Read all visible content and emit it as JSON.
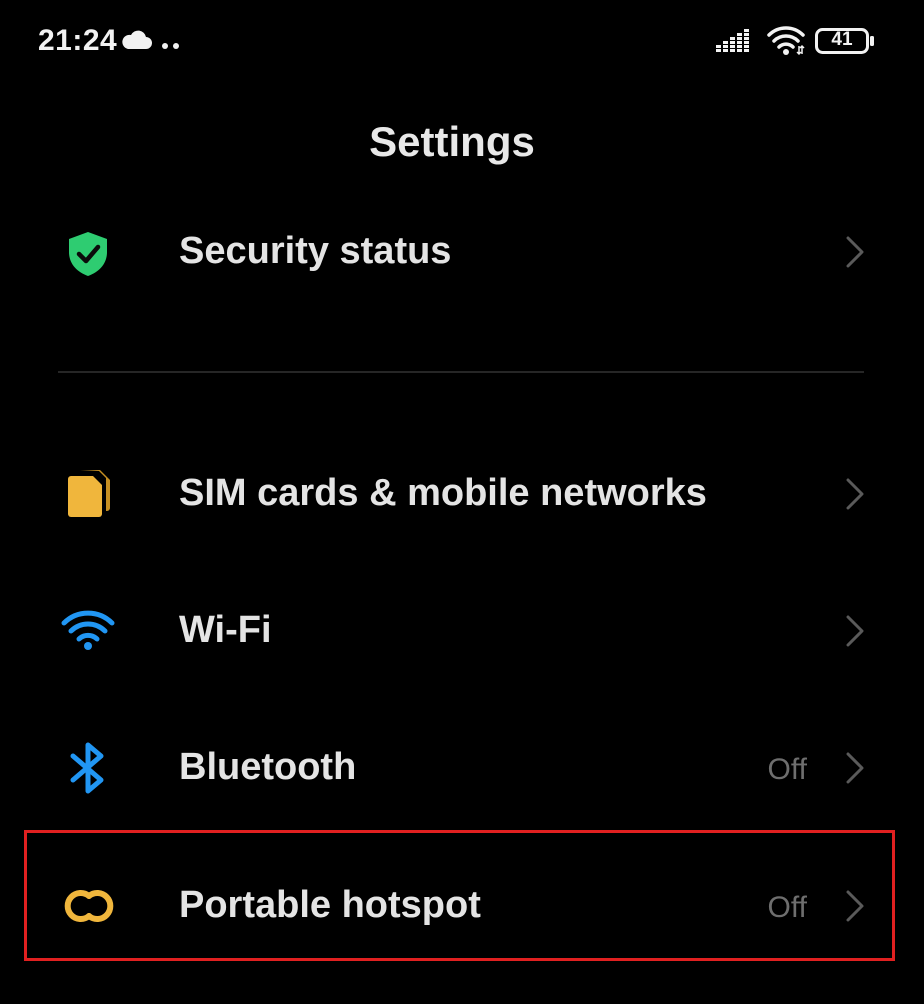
{
  "status_bar": {
    "time": "21:24",
    "battery": "41",
    "icons": [
      "cloud-icon",
      "more-dots-icon",
      "cellular-signal-icon",
      "wifi-icon",
      "battery-icon"
    ]
  },
  "header": {
    "title": "Settings"
  },
  "items": [
    {
      "label": "Security status",
      "value": "",
      "icon": "shield-check-icon",
      "icon_color": "#2ecc71"
    },
    {
      "label": "SIM cards & mobile networks",
      "value": "",
      "icon": "sim-card-icon",
      "icon_color": "#f0b63c"
    },
    {
      "label": "Wi-Fi",
      "value": "",
      "icon": "wifi-icon",
      "icon_color": "#2196f3"
    },
    {
      "label": "Bluetooth",
      "value": "Off",
      "icon": "bluetooth-icon",
      "icon_color": "#2196f3"
    },
    {
      "label": "Portable hotspot",
      "value": "Off",
      "icon": "hotspot-icon",
      "icon_color": "#f0b63c"
    }
  ],
  "colors": {
    "background": "#000000",
    "text": "#e4e4e4",
    "muted": "#6e6e6e",
    "highlight": "#e02020"
  }
}
